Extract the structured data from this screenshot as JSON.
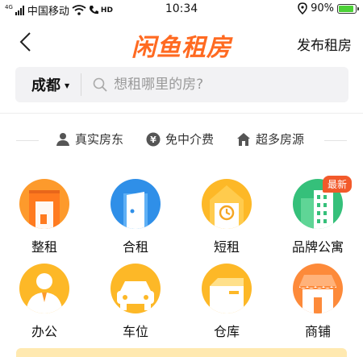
{
  "status_bar": {
    "signal_small": "4G",
    "carrier": "中国移动",
    "hd": "HD",
    "time": "10:34",
    "battery": "90%"
  },
  "nav": {
    "logo": "闲鱼租房",
    "publish_label": "发布租房"
  },
  "search": {
    "city": "成都",
    "placeholder": "想租哪里的房?"
  },
  "features": [
    {
      "icon": "person-icon",
      "label": "真实房东"
    },
    {
      "icon": "yen-icon",
      "label": "免中介费"
    },
    {
      "icon": "house-icon",
      "label": "超多房源"
    }
  ],
  "categories": [
    {
      "label": "整租",
      "icon": "building-icon"
    },
    {
      "label": "合租",
      "icon": "door-icon"
    },
    {
      "label": "短租",
      "icon": "clock-house-icon"
    },
    {
      "label": "品牌公寓",
      "icon": "apartment-icon",
      "badge": "最新"
    },
    {
      "label": "办公",
      "icon": "office-person-icon"
    },
    {
      "label": "车位",
      "icon": "car-icon"
    },
    {
      "label": "仓库",
      "icon": "box-icon"
    },
    {
      "label": "商铺",
      "icon": "shop-icon"
    }
  ],
  "colors": {
    "brand": "#ff6a21",
    "orange": "#fd9a2c",
    "blue": "#2f8fe8",
    "green": "#35c07a",
    "badge": "#f25a2b"
  }
}
